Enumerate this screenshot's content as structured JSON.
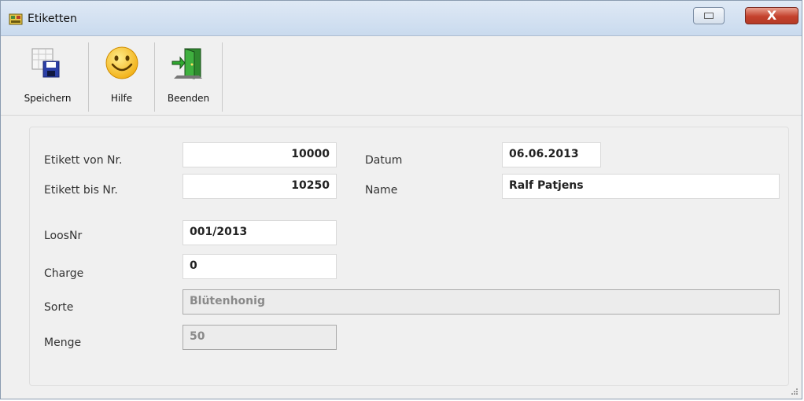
{
  "window": {
    "title": "Etiketten",
    "close_glyph": "X"
  },
  "toolbar": {
    "buttons": [
      {
        "label": "Speichern",
        "icon": "save-icon"
      },
      {
        "label": "Hilfe",
        "icon": "smiley-help-icon"
      },
      {
        "label": "Beenden",
        "icon": "exit-door-icon"
      }
    ]
  },
  "form": {
    "etikett_von": {
      "label": "Etikett von Nr.",
      "value": "10000"
    },
    "etikett_bis": {
      "label": "Etikett bis Nr.",
      "value": "10250"
    },
    "datum": {
      "label": "Datum",
      "value": "06.06.2013"
    },
    "name": {
      "label": "Name",
      "value": "Ralf Patjens"
    },
    "loosnr": {
      "label": "LoosNr",
      "value": "001/2013"
    },
    "charge": {
      "label": "Charge",
      "value": "0"
    },
    "sorte": {
      "label": "Sorte",
      "value": "Blütenhonig"
    },
    "menge": {
      "label": "Menge",
      "value": "50"
    }
  },
  "colors": {
    "window_bg": "#f0f0f0",
    "titlebar": "#c9daee",
    "close_button": "#c4412d"
  }
}
